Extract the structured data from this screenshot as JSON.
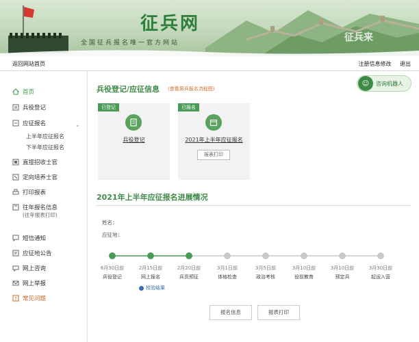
{
  "banner": {
    "title": "征兵网",
    "subtitle": "全国征兵报名唯一官方网站",
    "watermark": "征兵来"
  },
  "topbar": {
    "back": "返回网站首页",
    "modify": "注册信息修改",
    "logout": "退出"
  },
  "sidebar": {
    "home": "首页",
    "register": "兵役登记",
    "enlist": "应征报名",
    "first_half": "上半年应征报名",
    "second_half": "下半年应征报名",
    "direct": "直接招收士官",
    "targeted": "定向培养士官",
    "print": "打印报表",
    "history": "往年报名信息",
    "history_sub": "(往年报表打印)",
    "sms": "短信通知",
    "notice": "应征地公告",
    "consult": "网上咨询",
    "report": "网上举报",
    "faq": "常见问题"
  },
  "main": {
    "section_title": "兵役登记/应征信息",
    "flow_link": "(查看男兵报名流程图)",
    "robot_label": "咨询机器人",
    "card1": {
      "tag": "已登记",
      "label": "兵役登记"
    },
    "card2": {
      "tag": "已报名",
      "label": "2021年上半年应征报名",
      "button": "报表打印"
    },
    "progress_title": "2021年上半年应征报名进展情况",
    "name_label": "姓名：",
    "place_label": "应征地：",
    "result_link": "校验结果",
    "info_button": "报名信息",
    "print_button": "报表打印"
  },
  "timeline": {
    "steps": [
      {
        "date": "6月30日前",
        "label": "兵役登记",
        "done": true
      },
      {
        "date": "2月15日前",
        "label": "网上报名",
        "done": true
      },
      {
        "date": "2月20日前",
        "label": "兵员预征",
        "done": true
      },
      {
        "date": "3月1日前",
        "label": "体格检查",
        "done": false
      },
      {
        "date": "3月5日前",
        "label": "政治考核",
        "done": false
      },
      {
        "date": "3月10日前",
        "label": "役前教育",
        "done": false
      },
      {
        "date": "3月10日前",
        "label": "预定兵",
        "done": false
      },
      {
        "date": "3月30日前",
        "label": "起运入营",
        "done": false
      }
    ],
    "done_color": "#4a9b55",
    "todo_color": "#c9c9c9"
  }
}
